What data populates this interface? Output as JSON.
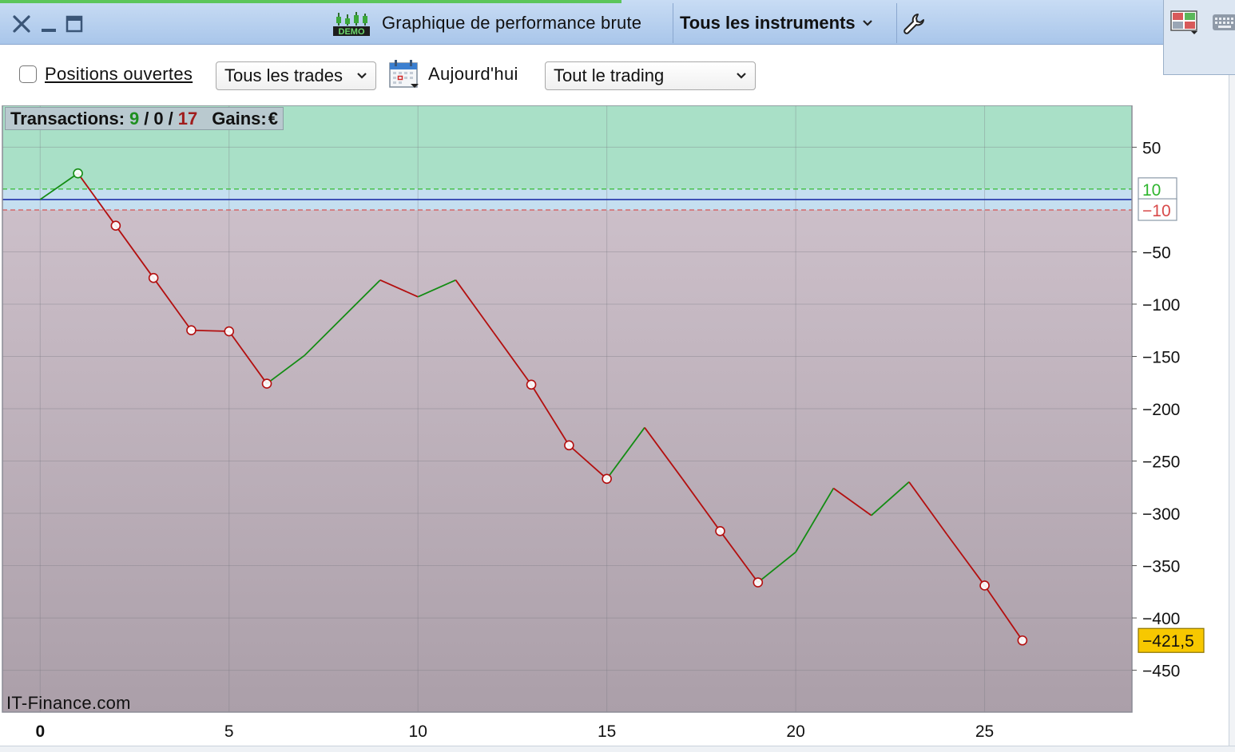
{
  "window": {
    "title": "Graphique de performance brute",
    "demo_badge": "DEMO",
    "instruments_label": "Tous les instruments",
    "icons": [
      "close-icon",
      "minimize-icon",
      "maximize-icon",
      "wrench-icon",
      "grid-layout-icon",
      "keyboard-icon"
    ]
  },
  "toolbar": {
    "open_positions_label": "Positions ouvertes",
    "open_positions_checked": false,
    "trades_filter": "Tous les trades",
    "date_label": "Aujourd'hui",
    "trading_filter": "Tout le trading"
  },
  "stats": {
    "transactions_label": "Transactions:",
    "wins": "9",
    "sep1": "/",
    "neutral": "0",
    "sep2": "/",
    "losses": "17",
    "gains_label": "Gains:",
    "currency": "€"
  },
  "watermark": "IT-Finance.com",
  "colors": {
    "gain_zone": "#a9e0c7",
    "neutral_zone": "#c5dff0",
    "loss_zone_top": "#ccbfc9",
    "loss_zone_bottom": "#ab9fa9",
    "up_segment": "#138c13",
    "down_segment": "#b30f0f",
    "zero_line": "#2233aa",
    "last_value_badge": "#f7c800"
  },
  "chart_data": {
    "type": "line",
    "x": [
      0,
      1,
      2,
      3,
      4,
      5,
      6,
      7,
      8,
      9,
      10,
      11,
      12,
      13,
      14,
      15,
      16,
      17,
      18,
      19,
      20,
      21,
      22,
      23,
      24,
      25,
      26
    ],
    "y": [
      0,
      25,
      -25,
      -75,
      -125,
      -126,
      -176,
      -149,
      -113,
      -77,
      -93,
      -77,
      -127,
      -177,
      -235,
      -267,
      -218,
      -267,
      -317,
      -366,
      -337,
      -276,
      -302,
      -270,
      -320,
      -369,
      -421.5
    ],
    "x_ticks": [
      "0",
      "5",
      "10",
      "15",
      "20",
      "25"
    ],
    "x_tick_values": [
      0,
      5,
      10,
      15,
      20,
      25
    ],
    "y_ticks": [
      "50",
      "-50",
      "-100",
      "-150",
      "-200",
      "-250",
      "-300",
      "-350",
      "-400",
      "-450"
    ],
    "y_tick_values": [
      50,
      -50,
      -100,
      -150,
      -200,
      -250,
      -300,
      -350,
      -400,
      -450
    ],
    "xlim": [
      -1,
      28.9
    ],
    "ylim": [
      -490,
      90
    ],
    "upper_threshold": 10,
    "lower_threshold": -10,
    "upper_threshold_label": "10",
    "lower_threshold_label": "-10",
    "last_value_label": "-421,5",
    "title": "",
    "xlabel": "",
    "ylabel": "",
    "grid": true
  }
}
